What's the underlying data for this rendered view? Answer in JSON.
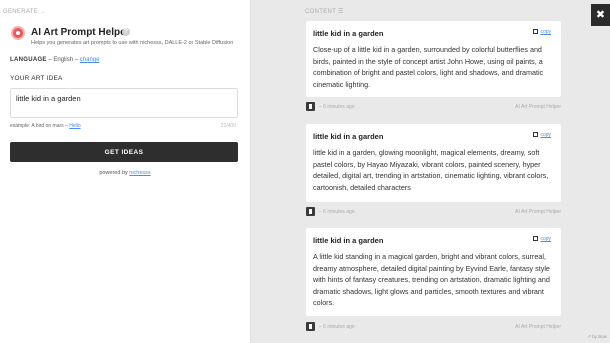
{
  "left_panel": {
    "generate_label": "GENERATE →",
    "app_title": "AI Art Prompt Helper",
    "app_subtitle": "Helps you generates art prompts to use with nichesss, DALLE-2 or Stable Diffusion",
    "language_label": "LANGUAGE",
    "language_value": "– English –",
    "language_change": "change",
    "idea_label": "YOUR ART IDEA",
    "idea_value": "little kid in a garden",
    "example_prefix": "example: A bird on mars –",
    "example_link": "Hello",
    "char_count": "22/400",
    "button_label": "GET IDEAS",
    "powered_prefix": "powered by",
    "powered_link": "nichesss"
  },
  "content_panel": {
    "label": "CONTENT ☰",
    "close_label": "✖",
    "copy_label": "copy",
    "cards": [
      {
        "title": "little kid in a garden",
        "text": "Close-up of a little kid in a garden, surrounded by colorful butterflies and birds, painted in the style of concept artist John Howe, using oil paints, a combination of bright and pastel colors, light and shadows, and dramatic cinematic lighting.",
        "time": "– 6 minutes ago",
        "source": "AI Art Prompt Helper"
      },
      {
        "title": "little kid in a garden",
        "text": "little kid in a garden, glowing moonlight, magical elements, dreamy, soft pastel colors, by Hayao Miyazaki, vibrant colors, painted scenery, hyper detailed, digital art, trending in artstation, cinematic lighting, vibrant colors, cartoonish, detailed characters",
        "time": "– 6 minutes ago",
        "source": "AI Art Prompt Helper"
      },
      {
        "title": "little kid in a garden",
        "text": "A little kid standing in a magical garden, bright and vibrant colors, surreal, dreamy atmosphere, detailed digital painting by Eyvind Earle, fantasy style with hints of fantasy creatures, trending on artstation, dramatic lighting and dramatic shadows, light glows and particles, smooth textures and vibrant colors.",
        "time": "– 6 minutes ago",
        "source": "AI Art Prompt Helper"
      }
    ]
  },
  "footer": {
    "by_label": "↗ by Bow"
  },
  "colors": {
    "accent": "#4a8ee6",
    "button": "#2e2e2e",
    "logo": "#e45a5a",
    "background": "#e9e9e9"
  },
  "icons": {
    "logo": "palette-icon",
    "help": "question-icon",
    "copy": "copy-icon",
    "delete": "trash-icon",
    "close": "close-icon"
  }
}
